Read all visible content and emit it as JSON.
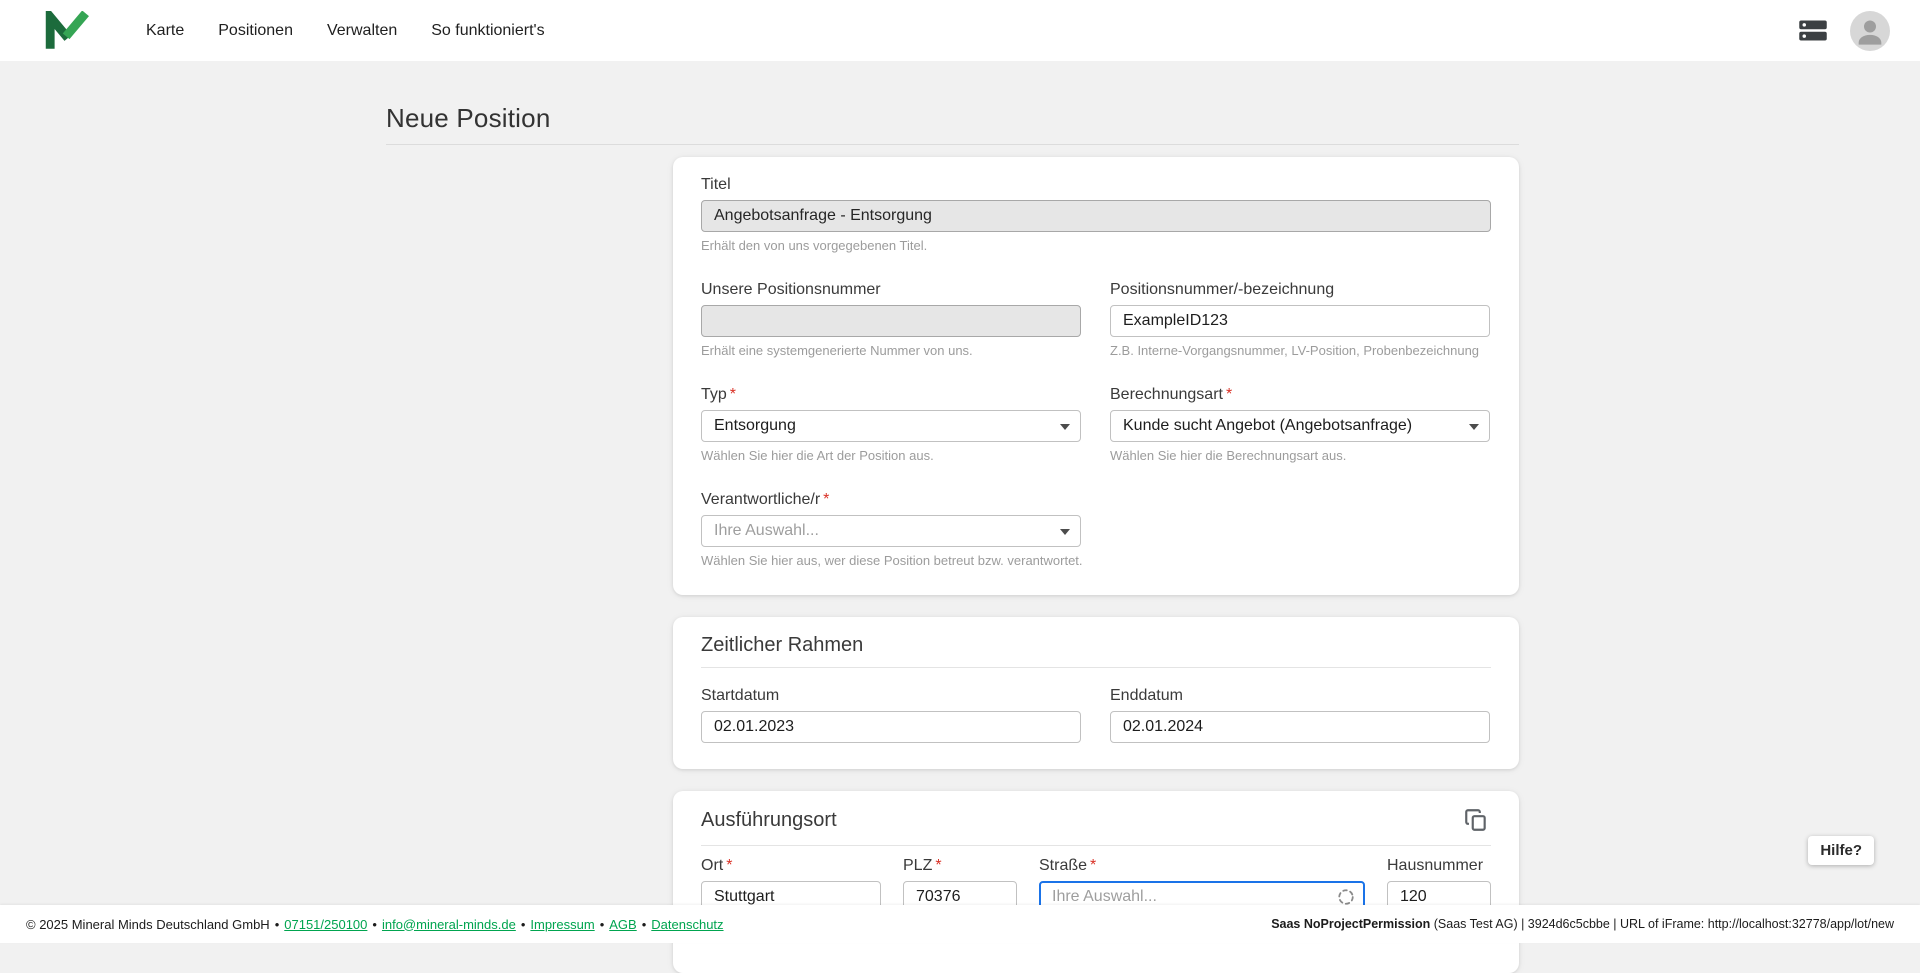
{
  "header": {
    "nav": [
      {
        "label": "Karte"
      },
      {
        "label": "Positionen"
      },
      {
        "label": "Verwalten"
      },
      {
        "label": "So funktioniert's"
      }
    ],
    "icons": {
      "logo": "mineral-minds-logo",
      "devices": "server-stack-icon",
      "account": "user-avatar-icon"
    }
  },
  "page": {
    "title": "Neue Position"
  },
  "misc": {
    "required_mark": "*"
  },
  "form": {
    "titel": {
      "label": "Titel",
      "value": "Angebotsanfrage - Entsorgung",
      "hint": "Erhält den von uns vorgegebenen Titel."
    },
    "unsere_positionsnummer": {
      "label": "Unsere Positionsnummer",
      "value": "",
      "hint": "Erhält eine systemgenerierte Nummer von uns."
    },
    "positionsnummer": {
      "label": "Positionsnummer/-bezeichnung",
      "value": "ExampleID123",
      "hint": "Z.B. Interne-Vorgangsnummer, LV-Position, Probenbezeichnung"
    },
    "typ": {
      "label": "Typ",
      "value": "Entsorgung",
      "hint": "Wählen Sie hier die Art der Position aus."
    },
    "berechnungsart": {
      "label": "Berechnungsart",
      "value": "Kunde sucht Angebot (Angebotsanfrage)",
      "hint": "Wählen Sie hier die Berechnungsart aus."
    },
    "verantwortliche": {
      "label": "Verantwortliche/r",
      "placeholder": "Ihre Auswahl...",
      "hint": "Wählen Sie hier aus, wer diese Position betreut bzw. verantwortet."
    }
  },
  "zeitlicher_rahmen": {
    "heading": "Zeitlicher Rahmen",
    "startdatum": {
      "label": "Startdatum",
      "value": "02.01.2023"
    },
    "enddatum": {
      "label": "Enddatum",
      "value": "02.01.2024"
    }
  },
  "ausfuehrungsort": {
    "heading": "Ausführungsort",
    "ort": {
      "label": "Ort",
      "value": "Stuttgart"
    },
    "plz": {
      "label": "PLZ",
      "value": "70376"
    },
    "strasse": {
      "label": "Straße",
      "placeholder": "Ihre Auswahl..."
    },
    "hausnummer": {
      "label": "Hausnummer",
      "value": "120"
    }
  },
  "help": {
    "label": "Hilfe?"
  },
  "footer": {
    "copyright": "© 2025 Mineral Minds Deutschland GmbH",
    "separator": "•",
    "links": [
      {
        "label": "07151/250100"
      },
      {
        "label": "info@mineral-minds.de"
      },
      {
        "label": "Impressum"
      },
      {
        "label": "AGB"
      },
      {
        "label": "Datenschutz"
      }
    ],
    "right_bold": "Saas NoProjectPermission",
    "right_rest": " (Saas Test AG) | 3924d6c5cbbe | URL of iFrame: http://localhost:32778/app/lot/new"
  },
  "colors": {
    "background": "#f1f1f1",
    "card": "#ffffff",
    "accent_green": "#00a44f",
    "logo_dark_green": "#1c6b3c",
    "logo_light_green": "#35a554",
    "focus_blue": "#1a73e8",
    "required_red": "#d93025"
  }
}
